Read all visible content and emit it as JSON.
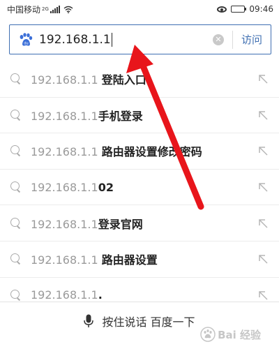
{
  "status_bar": {
    "carrier": "中国移动",
    "network": "2G",
    "time": "09:46",
    "battery_level": 0.7
  },
  "search": {
    "value": "192.168.1.1",
    "go_label": "访问",
    "logo_icon": "baidu-paw-icon",
    "clear_icon": "clear-icon"
  },
  "suggestions": [
    {
      "prefix": "192.168.1.1 ",
      "rest": "登陆入口"
    },
    {
      "prefix": "192.168.1.1",
      "rest": "手机登录"
    },
    {
      "prefix": "192.168.1.1 ",
      "rest": "路由器设置修改密码"
    },
    {
      "prefix": "192.168.1.1",
      "rest": "02"
    },
    {
      "prefix": "192.168.1.1",
      "rest": "登录官网"
    },
    {
      "prefix": "192.168.1.1 ",
      "rest": "路由器设置"
    },
    {
      "prefix": "192.168.1.1",
      "rest": "."
    }
  ],
  "voice": {
    "label": "按住说话 百度一下",
    "icon": "microphone-icon"
  },
  "colors": {
    "accent": "#3f6fb2",
    "arrow": "#e8151b",
    "suggestion_prefix": "#9a9a9a"
  }
}
